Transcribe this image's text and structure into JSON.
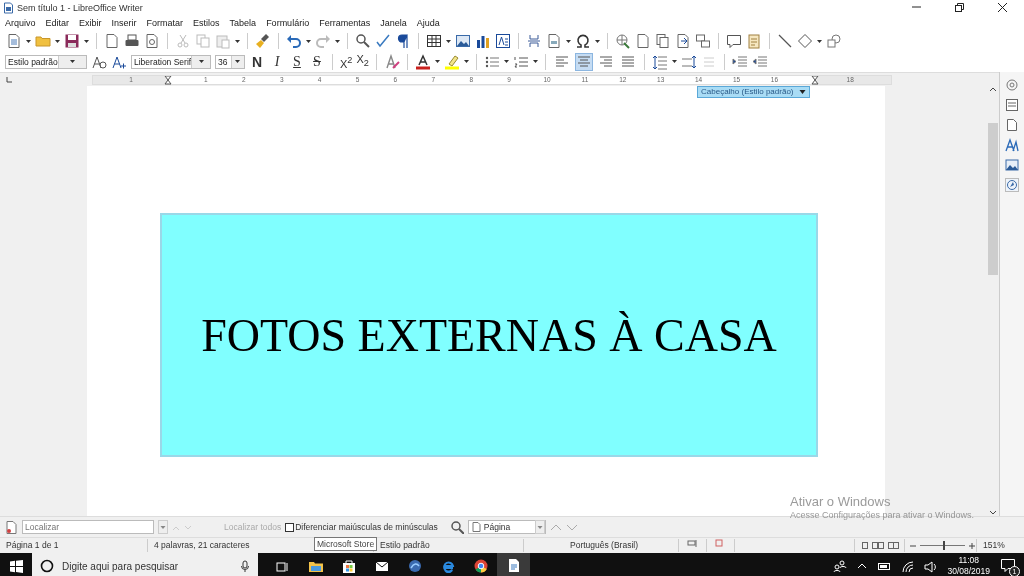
{
  "window": {
    "title": "Sem título 1 - LibreOffice Writer"
  },
  "menu": [
    "Arquivo",
    "Editar",
    "Exibir",
    "Inserir",
    "Formatar",
    "Estilos",
    "Tabela",
    "Formulário",
    "Ferramentas",
    "Janela",
    "Ajuda"
  ],
  "formatting": {
    "paragraph_style": "Estilo padrão",
    "font_name": "Liberation Serif",
    "font_size": "36",
    "buttons": [
      {
        "label": "N",
        "kind": "bold"
      },
      {
        "label": "I",
        "kind": "italic"
      },
      {
        "label": "S",
        "kind": "underline"
      },
      {
        "label": "S",
        "kind": "strike"
      },
      {
        "label": "X$^{2}$",
        "kind": "plain"
      },
      {
        "label": "X$_{2}$",
        "kind": "plain"
      }
    ],
    "alignment": [
      {
        "kind": "left",
        "selected": false
      },
      {
        "kind": "center",
        "selected": true
      },
      {
        "kind": "right",
        "selected": false
      },
      {
        "kind": "justify",
        "selected": false
      }
    ]
  },
  "ruler": {
    "labels": [
      "1",
      "1",
      "2",
      "3",
      "4",
      "5",
      "6",
      "7",
      "8",
      "9",
      "10",
      "11",
      "12",
      "13",
      "14",
      "15",
      "16",
      "18"
    ]
  },
  "document": {
    "header_tag": "Cabeçalho (Estilo padrão)",
    "frame_text": "FOTOS EXTERNAS À CASA"
  },
  "find_bar": {
    "placeholder": "Localizar",
    "find_all": "Localizar todos",
    "match_case": {
      "label": "Diferenciar maiúsculas de minúsculas",
      "checked": false
    },
    "search_by": "Página"
  },
  "status_bar": {
    "page": "Página 1 de 1",
    "words": "4 palavras, 21 caracteres",
    "tooltip": "Microsoft Store",
    "style": "Estilo padrão",
    "language": "Português (Brasil)",
    "zoom": {
      "level": 0.5,
      "reading": "151%"
    }
  },
  "activation": {
    "title": "Ativar o Windows",
    "message": "Acesse Configurações para ativar o Windows."
  },
  "taskbar": {
    "search_placeholder": "Digite aqui para pesquisar",
    "time": "11:08",
    "date": "30/08/2019",
    "notifications": "1"
  }
}
